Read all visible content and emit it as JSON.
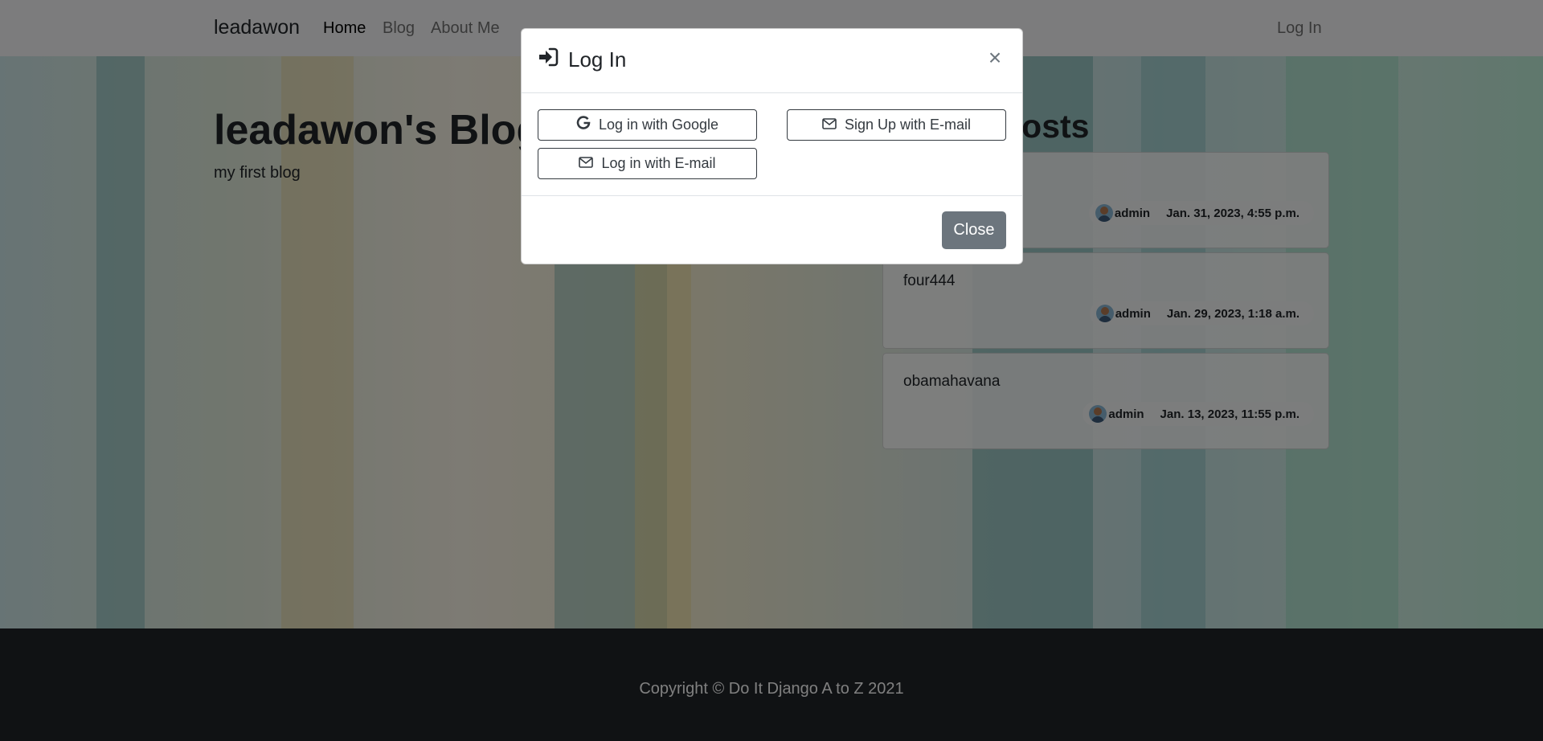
{
  "nav": {
    "brand": "leadawon",
    "links": [
      "Home",
      "Blog",
      "About Me"
    ],
    "login": "Log In"
  },
  "hero": {
    "title": "leadawon's Blog",
    "subtitle": "my first blog",
    "recent_title": "Recent posts"
  },
  "posts": [
    {
      "title": "",
      "author": "admin",
      "date": "Jan. 31, 2023, 4:55 p.m."
    },
    {
      "title": "four444",
      "author": "admin",
      "date": "Jan. 29, 2023, 1:18 a.m."
    },
    {
      "title": "obamahavana",
      "author": "admin",
      "date": "Jan. 13, 2023, 11:55 p.m."
    }
  ],
  "footer": {
    "copyright": "Copyright © Do It Django A to Z 2021"
  },
  "modal": {
    "title": "Log In",
    "close_symbol": "×",
    "buttons": {
      "google": "Log in with Google",
      "signup_email": "Sign Up with E-mail",
      "login_email": "Log in with E-mail"
    },
    "close_label": "Close"
  },
  "icons": {
    "login": "sign-in-icon",
    "google": "google-icon",
    "envelope": "envelope-icon",
    "avatar": "avatar-icon"
  },
  "colors": {
    "footer_bg": "#212529",
    "close_button": "#6c757d",
    "outline": "#343a40"
  }
}
